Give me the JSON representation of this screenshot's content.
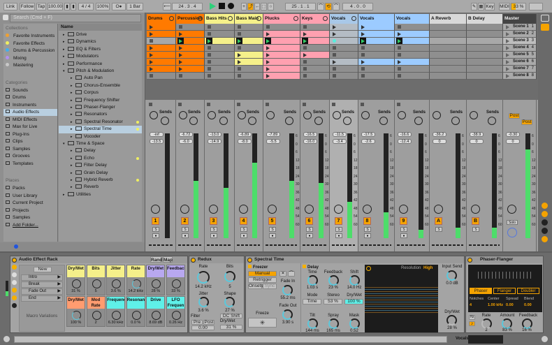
{
  "toolbar": {
    "link": "Link",
    "follow": "Follow",
    "tap": "Tap",
    "tempo": "100.00",
    "signature": "4 / 4",
    "zoom": "100%",
    "metronome": "O●",
    "quantize": "1 Bar",
    "position": "24 .  3 .  4",
    "loop_start": "25 .  1 .  1",
    "loop_length": "4 .  0 .  0",
    "key": "Key",
    "midi": "MIDI",
    "cpu": "33 %"
  },
  "browser": {
    "search_placeholder": "Search (Cmd + F)",
    "collections_header": "Collections",
    "collections": [
      {
        "label": "Favorite Instruments",
        "color": "#f0a030"
      },
      {
        "label": "Favorite Effects",
        "color": "#f0f060"
      },
      {
        "label": "Drums & Percussion",
        "color": "#40b0f0"
      },
      {
        "label": "Mixing",
        "color": "#b090f0"
      },
      {
        "label": "Mastering",
        "color": "#c8c8c8"
      }
    ],
    "categories_header": "Categories",
    "categories": [
      "Sounds",
      "Drums",
      "Instruments",
      "Audio Effects",
      "MIDI Effects",
      "Max for Live",
      "Plug-Ins",
      "Clips",
      "Samples",
      "Grooves",
      "Templates"
    ],
    "selected_category": "Audio Effects",
    "places_header": "Places",
    "places": [
      "Packs",
      "User Library",
      "Current Project",
      "Projects",
      "Samples",
      "Add Folder..."
    ],
    "name_header": "Name",
    "items": [
      {
        "label": "Drive",
        "level": 0,
        "open": false
      },
      {
        "label": "Dynamics",
        "level": 0
      },
      {
        "label": "EQ & Filters",
        "level": 0
      },
      {
        "label": "Modulators",
        "level": 0
      },
      {
        "label": "Performance",
        "level": 0
      },
      {
        "label": "Pitch & Modulation",
        "level": 0,
        "open": true
      },
      {
        "label": "Auto Pan",
        "level": 1
      },
      {
        "label": "Chorus-Ensemble",
        "level": 1
      },
      {
        "label": "Corpus",
        "level": 1
      },
      {
        "label": "Frequency Shifter",
        "level": 1
      },
      {
        "label": "Phaser-Flanger",
        "level": 1
      },
      {
        "label": "Resonators",
        "level": 1
      },
      {
        "label": "Spectral Resonator",
        "level": 1,
        "new": true
      },
      {
        "label": "Spectral Time",
        "level": 1,
        "new": true,
        "selected": true
      },
      {
        "label": "Vocoder",
        "level": 1
      },
      {
        "label": "Time & Space",
        "level": 0,
        "open": true
      },
      {
        "label": "Delay",
        "level": 1
      },
      {
        "label": "Echo",
        "level": 1,
        "new": true
      },
      {
        "label": "Filter Delay",
        "level": 1
      },
      {
        "label": "Grain Delay",
        "level": 1
      },
      {
        "label": "Hybrid Reverb",
        "level": 1,
        "new": true
      },
      {
        "label": "Reverb",
        "level": 1
      },
      {
        "label": "Utilities",
        "level": 0
      }
    ]
  },
  "tracks": [
    {
      "name": "Drums",
      "color": "#ff7a00",
      "clips": [
        "clip",
        "clip",
        "stop",
        "clip",
        "clip",
        "clip",
        "clip",
        "stop"
      ],
      "vol": "-inf",
      "pan": "-13.5",
      "num": "1",
      "level": 0
    },
    {
      "name": "Percussion",
      "color": "#ff7a00",
      "clips": [
        "stop",
        "clip",
        "playing",
        "clip",
        "clip",
        "clip",
        "clip",
        "stop"
      ],
      "vol": "-6.72",
      "pan": "-6.0",
      "num": "2",
      "level": 0.55
    },
    {
      "name": "Bass Hits",
      "color": "#f5f08a",
      "clips": [
        "stop",
        "stop",
        "playing",
        "stop",
        "stop",
        "stop",
        "stop",
        "stop"
      ],
      "vol": "-13.0",
      "pan": "-14.9",
      "num": "3",
      "level": 0.48
    },
    {
      "name": "Bass Main",
      "color": "#f5f08a",
      "clips": [
        "stop",
        "stop",
        "playing",
        "stop",
        "clip",
        "clip",
        "stop",
        "stop"
      ],
      "vol": "-6.89",
      "pan": "-8.0",
      "num": "4",
      "level": 0.72
    },
    {
      "name": "Plucks",
      "color": "#ffa0b0",
      "clips": [
        "stop",
        "clip",
        "playing",
        "clip",
        "clip",
        "clip",
        "clip",
        "clip"
      ],
      "vol": "-7.89",
      "pan": "-5.5",
      "num": "5",
      "level": 0.55
    },
    {
      "name": "Keys",
      "color": "#ffa0b0",
      "clips": [
        "stop",
        "clip",
        "playing",
        "stop",
        "clip",
        "stop",
        "stop",
        "stop"
      ],
      "vol": "-16.5",
      "pan": "-16.0",
      "num": "6",
      "level": 0.53
    },
    {
      "name": "Vocals",
      "color": "#a8c8e8",
      "clips": [
        "group",
        "group",
        "groupplay",
        "stop",
        "stop",
        "group",
        "stop",
        "stop"
      ],
      "vol": "-11.5",
      "pan": "-3.4",
      "num": "7",
      "level": 0.35
    },
    {
      "name": "Vocals",
      "color": "#9ccbff",
      "clips": [
        "clip",
        "clip",
        "playing",
        "stop",
        "stop",
        "clip",
        "stop",
        "stop"
      ],
      "vol": "-17.5",
      "pan": "-2.6",
      "num": "8",
      "level": 0.25
    },
    {
      "name": "Vocals",
      "color": "#9ccbff",
      "clips": [
        "stop",
        "clip",
        "playing",
        "stop",
        "stop",
        "clip",
        "stop",
        "stop"
      ],
      "vol": "-16.6",
      "pan": "-12.4",
      "num": "9",
      "level": 0.08
    },
    {
      "name": "A Reverb",
      "color": "#d8d8d8",
      "clips": [
        "none",
        "none",
        "none",
        "none",
        "none",
        "none",
        "none",
        "none"
      ],
      "vol": "-36.2",
      "pan": "0",
      "num": "A",
      "level": 0.1
    },
    {
      "name": "B Delay",
      "color": "#d8d8d8",
      "clips": [
        "none",
        "none",
        "none",
        "none",
        "none",
        "none",
        "none",
        "none"
      ],
      "vol": "-38.9",
      "pan": "0",
      "num": "B",
      "level": 0.1
    }
  ],
  "master": {
    "name": "Master",
    "scenes": [
      "Scene 1",
      "Scene 2",
      "Scene 3",
      "Scene 4",
      "Scene 5",
      "Scene 6",
      "Scene 7",
      "Scene 8"
    ],
    "vol": "-0.30",
    "pan": "0",
    "solo": "Solo",
    "post": "Post",
    "level": 0.85
  },
  "mixer": {
    "sends_label": "Sends",
    "solo": "S",
    "scale": [
      "6",
      "0",
      "6",
      "12",
      "18",
      "24",
      "30",
      "36",
      "42",
      "48",
      "54",
      "60"
    ]
  },
  "rack": {
    "title": "Audio Effect Rack",
    "rand": "Rand",
    "map": "Map",
    "new": "New",
    "variations": [
      "Intro",
      "Break",
      "Fade Out",
      "End"
    ],
    "variations_label": "Macro Variations",
    "macros": [
      {
        "label": "Dry/Wet",
        "value": "31 %",
        "color": "#f5f08a"
      },
      {
        "label": "Bits",
        "value": "5",
        "color": "#f5f08a"
      },
      {
        "label": "Jitter",
        "value": "3.6 %",
        "color": "#f5f08a"
      },
      {
        "label": "Rate",
        "value": "14.2 kHz",
        "color": "#f5f08a"
      },
      {
        "label": "Dry/Wet",
        "value": "28 %",
        "color": "#b8a8f0"
      },
      {
        "label": "Feedback",
        "value": "33 %",
        "color": "#b8a8f0"
      },
      {
        "label": "Dry/Wet",
        "value": "100 %",
        "color": "#ff9c70"
      },
      {
        "label": "Mod Rate",
        "value": "2",
        "color": "#ff9c70"
      },
      {
        "label": "Frequency",
        "value": "6.30 kHz",
        "color": "#5ff0e8"
      },
      {
        "label": "Resonance",
        "value": "0.0 %",
        "color": "#5ff0e8"
      },
      {
        "label": "Drive",
        "value": "8.69 dB",
        "color": "#5ff0e8"
      },
      {
        "label": "LFO Frequen",
        "value": "0.26 Hz",
        "color": "#5ff0e8"
      }
    ]
  },
  "redux": {
    "title": "Redux",
    "rate_label": "Rate",
    "rate": "14.2 kHz",
    "bits_label": "Bits",
    "bits": "5",
    "jitter_label": "Jitter",
    "jitter": "3.6 %",
    "shape_label": "Shape",
    "shape": "27 %",
    "filter_label": "Filter",
    "pre": "Pre",
    "post": "Post",
    "filter_value": "0.00",
    "dc_shift": "DC Shift",
    "drywet_label": "Dry/Wet",
    "drywet": "31 %"
  },
  "spectral": {
    "title": "Spectral Time",
    "freezer": "Freezer",
    "manual": "Manual",
    "retrigger": "Retrigger",
    "onsets": "Onsets",
    "sync": "Sync",
    "freeze": "Freeze",
    "freeze_icon": "✳",
    "fade_in_label": "Fade In",
    "fade_in": "55.2 ms",
    "fade_out_label": "Fade Out",
    "fade_out": "3.90 s",
    "delay": "Delay",
    "time_label": "Time",
    "time": "1.03 s",
    "feedback_label": "Feedback",
    "feedback": "23 %",
    "shift_label": "Shift",
    "shift": "14.0 Hz",
    "mode_label": "Mode",
    "mode": "Time",
    "stereo_label": "Stereo",
    "stereo": "53 %",
    "drywet_label": "Dry/Wet",
    "drywet": "100 %",
    "tilt_label": "Tilt",
    "tilt": "144 ms",
    "spray_label": "Spray",
    "spray": "165 ms",
    "mask_label": "Mask",
    "mask": "0.52",
    "resolution_label": "Resolution",
    "resolution": "High",
    "input_send_label": "Input Send",
    "input_send": "0.0 dB",
    "out_drywet_label": "Dry/Wet",
    "out_drywet": "28 %"
  },
  "phaser": {
    "title": "Phaser-Flanger",
    "modes": [
      "Phaser",
      "Flanger",
      "Doubler"
    ],
    "active_mode": "Phaser",
    "notches_label": "Notches",
    "notches": "4",
    "center_label": "Center",
    "center": "1.00 kHz",
    "spread_label": "Spread",
    "spread": "0.00",
    "blend_label": "Blend",
    "blend": "0.00",
    "hz": "Hz",
    "rate_label": "Rate",
    "rate": "2",
    "amount_label": "Amount",
    "amount": "83 %",
    "feedback_label": "Feedback",
    "feedback": "16 %"
  },
  "statusbar": {
    "track": "Vocals"
  },
  "colors": {
    "accent": "#f5a300",
    "meter": "#4ddd6a",
    "playing": "#33cc66"
  }
}
